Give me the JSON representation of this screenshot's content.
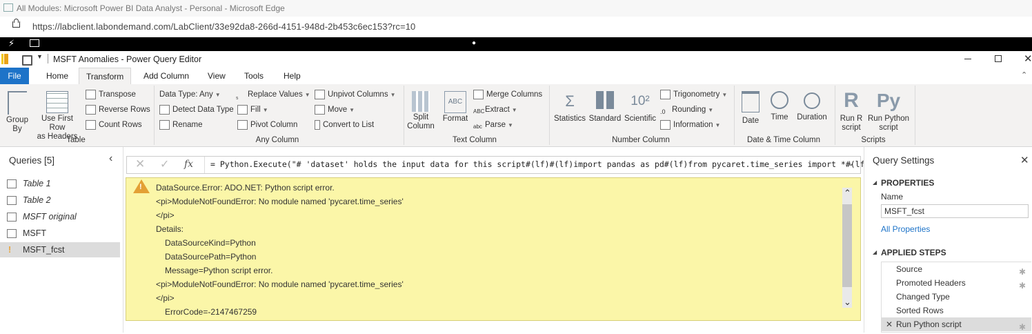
{
  "browser": {
    "title": "All Modules: Microsoft Power BI Data Analyst - Personal - Microsoft Edge",
    "url": "https://labclient.labondemand.com/LabClient/33e92da8-266d-4151-948d-2b453c6ec153?rc=10"
  },
  "app": {
    "title": "MSFT Anomalies - Power Query Editor"
  },
  "tabs": [
    "File",
    "Home",
    "Transform",
    "Add Column",
    "View",
    "Tools",
    "Help"
  ],
  "active_tab": "Transform",
  "ribbon": {
    "table": {
      "group_label": "Table",
      "group_by": "Group\nBy",
      "use_first_row": "Use First Row\nas Headers",
      "transpose": "Transpose",
      "reverse_rows": "Reverse Rows",
      "count_rows": "Count Rows"
    },
    "any_column": {
      "group_label": "Any Column",
      "data_type": "Data Type: Any",
      "detect_data_type": "Detect Data Type",
      "rename": "Rename",
      "replace_values": "Replace Values",
      "fill": "Fill",
      "pivot_column": "Pivot Column",
      "unpivot_columns": "Unpivot Columns",
      "move": "Move",
      "convert_to_list": "Convert to List"
    },
    "text_column": {
      "group_label": "Text Column",
      "split_column": "Split\nColumn",
      "format": "Format",
      "merge_columns": "Merge Columns",
      "extract": "Extract",
      "parse": "Parse"
    },
    "number_column": {
      "group_label": "Number Column",
      "statistics": "Statistics",
      "standard": "Standard",
      "scientific": "Scientific",
      "trigonometry": "Trigonometry",
      "rounding": "Rounding",
      "information": "Information"
    },
    "date_time_column": {
      "group_label": "Date & Time Column",
      "date": "Date",
      "time": "Time",
      "duration": "Duration"
    },
    "scripts": {
      "group_label": "Scripts",
      "run_r": "Run R\nscript",
      "run_python": "Run Python\nscript"
    }
  },
  "queries": {
    "header": "Queries [5]",
    "items": [
      {
        "label": "Table 1",
        "italic": true,
        "error": false
      },
      {
        "label": "Table 2",
        "italic": true,
        "error": false
      },
      {
        "label": "MSFT original",
        "italic": true,
        "error": false
      },
      {
        "label": "MSFT",
        "italic": false,
        "error": false
      },
      {
        "label": "MSFT_fcst",
        "italic": false,
        "error": true
      }
    ],
    "selected_index": 4
  },
  "formula": {
    "text": "= Python.Execute(\"# 'dataset' holds the input data for this script#(lf)#(lf)import pandas as pd#(lf)from pycaret.time_series import *#(lf)"
  },
  "error": {
    "lines": [
      {
        "text": "DataSource.Error: ADO.NET: Python script error.",
        "indent": 0
      },
      {
        "text": "<pi>ModuleNotFoundError: No module named 'pycaret.time_series'",
        "indent": 0
      },
      {
        "text": "</pi>",
        "indent": 0
      },
      {
        "text": "Details:",
        "indent": 0
      },
      {
        "text": "DataSourceKind=Python",
        "indent": 1
      },
      {
        "text": "DataSourcePath=Python",
        "indent": 1
      },
      {
        "text": "Message=Python script error.",
        "indent": 1
      },
      {
        "text": "<pi>ModuleNotFoundError: No module named 'pycaret.time_series'",
        "indent": 0
      },
      {
        "text": "</pi>",
        "indent": 0
      },
      {
        "text": "ErrorCode=-2147467259",
        "indent": 1
      }
    ]
  },
  "settings": {
    "header": "Query Settings",
    "properties_header": "PROPERTIES",
    "name_label": "Name",
    "name_value": "MSFT_fcst",
    "all_properties": "All Properties",
    "applied_steps_header": "APPLIED STEPS",
    "steps": [
      {
        "label": "Source",
        "gear": true
      },
      {
        "label": "Promoted Headers",
        "gear": true
      },
      {
        "label": "Changed Type",
        "gear": false
      },
      {
        "label": "Sorted Rows",
        "gear": false
      },
      {
        "label": "Run Python script",
        "gear": true
      }
    ],
    "selected_step_index": 4
  },
  "colors": {
    "file_tab": "#1d73c8",
    "error_bg": "#fbf6a8",
    "link": "#1d73c8",
    "warning": "#e8a33a"
  }
}
